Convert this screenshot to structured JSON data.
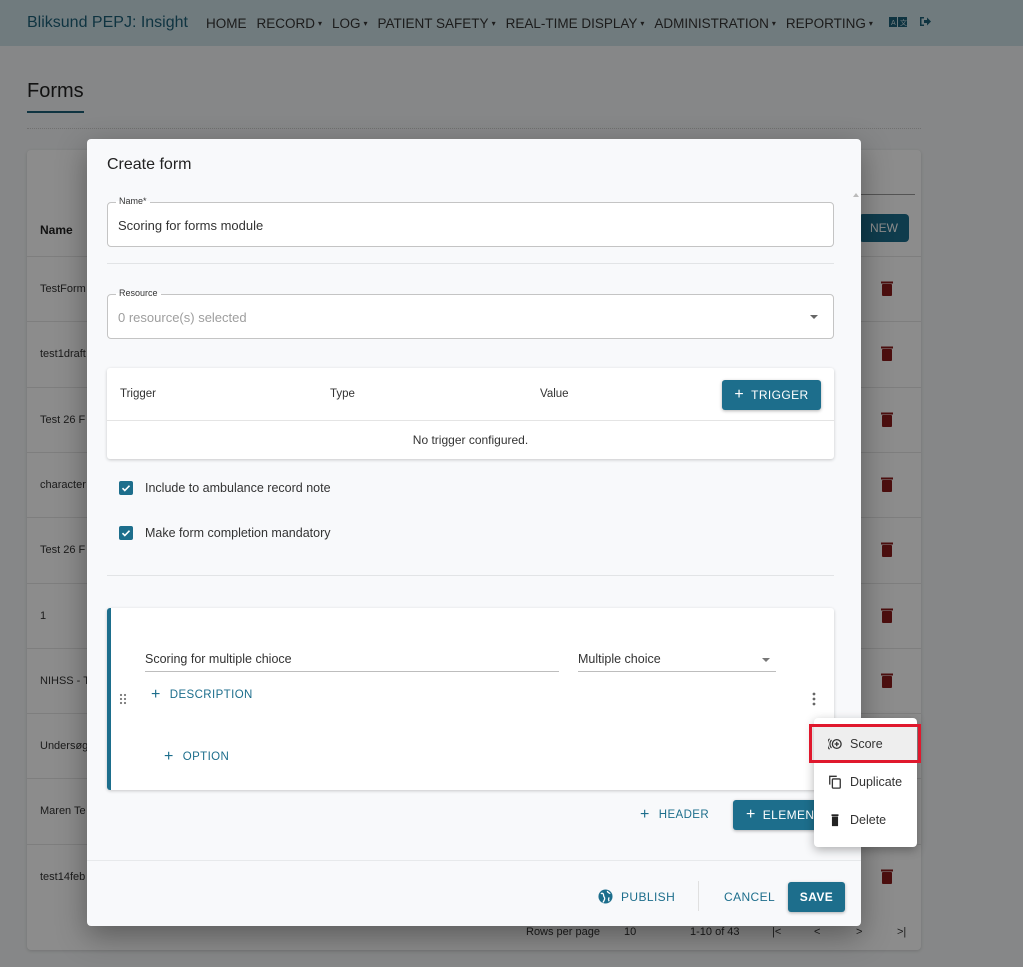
{
  "navbar": {
    "brand": "Bliksund PEPJ: Insight",
    "items": [
      {
        "label": "HOME",
        "has_dropdown": false
      },
      {
        "label": "RECORD",
        "has_dropdown": true
      },
      {
        "label": "LOG",
        "has_dropdown": true
      },
      {
        "label": "PATIENT SAFETY",
        "has_dropdown": true
      },
      {
        "label": "REAL-TIME DISPLAY",
        "has_dropdown": true
      },
      {
        "label": "ADMINISTRATION",
        "has_dropdown": true
      },
      {
        "label": "REPORTING",
        "has_dropdown": true
      }
    ],
    "icons": [
      "language-icon",
      "logout-icon"
    ],
    "caret": "▾"
  },
  "page": {
    "title": "Forms",
    "list": {
      "column_name": "Name",
      "new_button": "NEW",
      "rows": [
        {
          "name": "TestForm"
        },
        {
          "name": "test1draft"
        },
        {
          "name": "Test 26 F"
        },
        {
          "name": "character"
        },
        {
          "name": "Test 26 F"
        },
        {
          "name": "1"
        },
        {
          "name": "NIHSS - T"
        },
        {
          "name": "Undersøg"
        },
        {
          "name": "Maren Te"
        },
        {
          "name": "test14feb"
        }
      ],
      "pagination": {
        "rows_per_page_label": "Rows per page",
        "rows_per_page": "10",
        "range": "1-10 of 43",
        "first": "|<",
        "prev": "<",
        "next": ">",
        "last": ">|"
      }
    }
  },
  "dialog": {
    "title": "Create form",
    "name_field": {
      "label": "Name*",
      "value": "Scoring for forms module"
    },
    "resource_field": {
      "label": "Resource",
      "placeholder": "0 resource(s) selected"
    },
    "trigger_table": {
      "columns": [
        "Trigger",
        "Type",
        "Value"
      ],
      "add_button": "TRIGGER",
      "empty_text": "No trigger configured."
    },
    "checkboxes": [
      {
        "label": "Include to ambulance record note",
        "checked": true
      },
      {
        "label": "Make form completion mandatory",
        "checked": true
      }
    ],
    "element": {
      "question": "Scoring for multiple chioce",
      "type": "Multiple choice",
      "add_description": "DESCRIPTION",
      "add_option": "OPTION"
    },
    "add_header": "HEADER",
    "add_element": "ELEMENT",
    "footer": {
      "publish": "PUBLISH",
      "cancel": "CANCEL",
      "save": "SAVE"
    }
  },
  "context_menu": {
    "items": [
      {
        "label": "Score",
        "icon": "score-icon",
        "highlighted": true
      },
      {
        "label": "Duplicate",
        "icon": "duplicate-icon",
        "highlighted": false
      },
      {
        "label": "Delete",
        "icon": "delete-icon",
        "highlighted": false
      }
    ]
  },
  "colors": {
    "primary": "#1d6e8c",
    "danger": "#8b1c1c",
    "highlight": "#e0182d"
  }
}
